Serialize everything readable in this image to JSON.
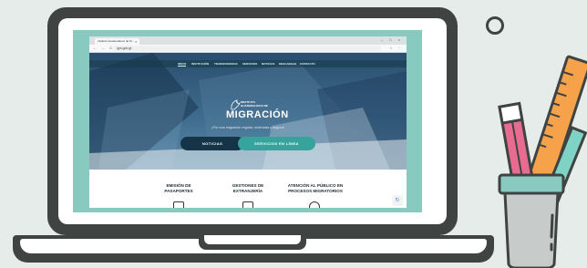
{
  "browser": {
    "tab_title": "Instituto Guatemalteco de M...",
    "tab_close": "×",
    "window_controls": "– □ ×",
    "nav_arrows": "← → C",
    "url": "igm.gob.gt",
    "addr_icons": "☆ ⋮"
  },
  "site": {
    "nav": [
      "INICIO",
      "INSTITUCIÓN",
      "TRANSPARENCIA",
      "SERVICIOS",
      "NOTICIAS",
      "DESCARGAS",
      "CONTACTO"
    ],
    "logo_small": "INSTITUTO GUATEMALTECO DE",
    "logo_big": "MIGRACIÓN",
    "tagline": "¡Por una migración regular, ordenada y segura!",
    "btn_news": "NOTICIAS",
    "btn_services": "SERVICIOS EN LÍNEA",
    "features": [
      {
        "title": "EMISIÓN DE\nPASAPORTES"
      },
      {
        "title": "GESTIONES DE\nEXTRANJERÍA"
      },
      {
        "title": "ATENCIÓN AL PÚBLICO EN\nPROCESOS MIGRATORIOS"
      }
    ],
    "captcha_icon": "recaptcha-icon"
  },
  "colors": {
    "background": "#e6ecea",
    "laptop": "#3f4342",
    "screen_border": "#88c9c0",
    "hero_dark": "#2a4d6e",
    "button_dark": "#153447",
    "button_teal": "#36a39c",
    "pencil_pink": "#e86c91",
    "ruler_orange": "#f5a24b"
  }
}
